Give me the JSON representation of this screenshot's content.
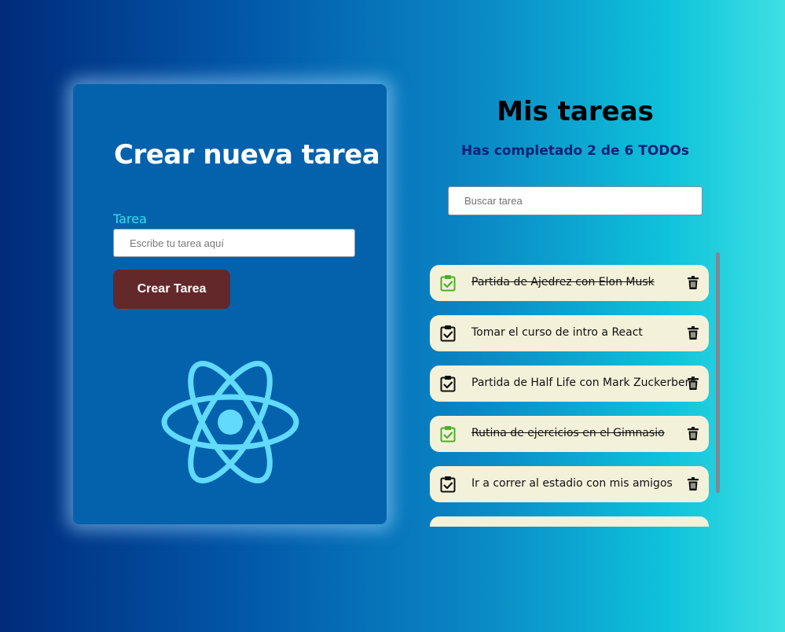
{
  "create_panel": {
    "title": "Crear nueva tarea",
    "field_label": "Tarea",
    "input_value": "",
    "input_placeholder": "Escribe tu tarea aquí",
    "button_label": "Crear Tarea",
    "logo_icon": "react-logo-icon"
  },
  "list_panel": {
    "title": "Mis tareas",
    "counter_text": "Has completado 2 de 6 TODOs",
    "search_value": "",
    "search_placeholder": "Buscar tarea"
  },
  "todos": [
    {
      "text": "Partida de Ajedrez con Elon Musk",
      "completed": true
    },
    {
      "text": "Tomar el curso de intro a React",
      "completed": false
    },
    {
      "text": "Partida de Half Life con Mark Zuckerberg",
      "completed": false
    },
    {
      "text": "Rutina de ejercicios en el Gimnasio",
      "completed": true
    },
    {
      "text": "Ir a correr al estadio con mis amigos",
      "completed": false
    },
    {
      "text": "",
      "completed": false
    }
  ],
  "icons": {
    "check": "clipboard-check-icon",
    "delete": "trash-icon"
  },
  "colors": {
    "card_bg": "#0462ad",
    "accent_label": "#34e0e8",
    "button_bg": "#63282a",
    "counter_text": "#0b1f7a",
    "todo_bg": "#f4f1da",
    "check_done": "#4caf2a",
    "check_pending": "#111111",
    "react_logo": "#61dafb"
  }
}
